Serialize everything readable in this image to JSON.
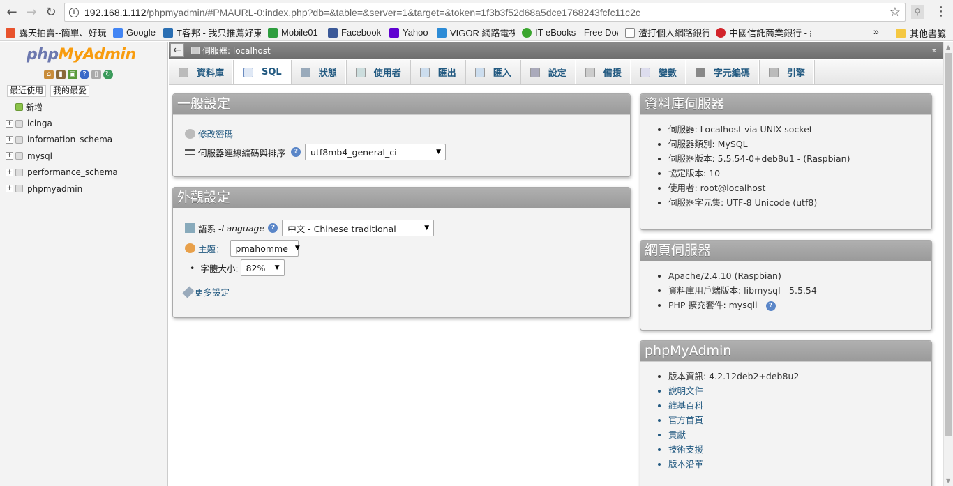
{
  "browser": {
    "url_host": "192.168.1.112",
    "url_rest": "/phpmyadmin/#PMAURL-0:index.php?db=&table=&server=1&target=&token=1f3b3f52d68a5dce1768243fcfc11c2c",
    "bookmarks": [
      {
        "label": "露天拍賣--簡單、好玩",
        "color": "#e8532d"
      },
      {
        "label": "Google",
        "color": "#4285f4"
      },
      {
        "label": "T客邦 - 我只推薦好東",
        "color": "#2b6fb3"
      },
      {
        "label": "Mobile01",
        "color": "#2e9e3f"
      },
      {
        "label": "Facebook",
        "color": "#3b5998"
      },
      {
        "label": "Yahoo",
        "color": "#5f01d1"
      },
      {
        "label": "VIGOR 網路電視",
        "color": "#2c8bd6"
      },
      {
        "label": "IT eBooks - Free Dow",
        "color": "#3aa52e"
      },
      {
        "label": "渣打個人網路銀行",
        "color": "#dddddd"
      },
      {
        "label": "中國信託商業銀行 - 網",
        "color": "#d2232a"
      }
    ],
    "more": "»",
    "other_bookmarks": "其他書籤"
  },
  "sidebar": {
    "logo_php": "php",
    "logo_myadmin": "MyAdmin",
    "recent": "最近使用",
    "favorites": "我的最愛",
    "new_label": "新增",
    "databases": [
      "icinga",
      "information_schema",
      "mysql",
      "performance_schema",
      "phpmyadmin"
    ]
  },
  "serverbar": {
    "label": "伺服器: localhost"
  },
  "tabs": [
    {
      "label": "資料庫",
      "icon": "database-icon"
    },
    {
      "label": "SQL",
      "icon": "sql-icon"
    },
    {
      "label": "狀態",
      "icon": "status-icon"
    },
    {
      "label": "使用者",
      "icon": "users-icon"
    },
    {
      "label": "匯出",
      "icon": "export-icon"
    },
    {
      "label": "匯入",
      "icon": "import-icon"
    },
    {
      "label": "設定",
      "icon": "wrench-icon"
    },
    {
      "label": "備援",
      "icon": "replication-icon"
    },
    {
      "label": "變數",
      "icon": "variables-icon"
    },
    {
      "label": "字元編碼",
      "icon": "charset-icon"
    },
    {
      "label": "引擎",
      "icon": "engine-icon"
    }
  ],
  "general": {
    "title": "一般設定",
    "change_password": "修改密碼",
    "collation_label": "伺服器連線編碼與排序",
    "collation_value": "utf8mb4_general_ci"
  },
  "appearance": {
    "title": "外觀設定",
    "language_label": "語系 - ",
    "language_italic": "Language",
    "language_value": "中文 - Chinese traditional",
    "theme_label": "主題：",
    "theme_value": "pmahomme",
    "font_label": "字體大小:",
    "font_value": "82%",
    "more_settings": "更多設定"
  },
  "db_server": {
    "title": "資料庫伺服器",
    "items": [
      "伺服器: Localhost via UNIX socket",
      "伺服器類別: MySQL",
      "伺服器版本: 5.5.54-0+deb8u1 - (Raspbian)",
      "協定版本: 10",
      "使用者: root@localhost",
      "伺服器字元集: UTF-8 Unicode (utf8)"
    ]
  },
  "web_server": {
    "title": "網頁伺服器",
    "items": [
      "Apache/2.4.10 (Raspbian)",
      "資料庫用戶端版本: libmysql - 5.5.54",
      "PHP 擴充套件: mysqli"
    ]
  },
  "pma": {
    "title": "phpMyAdmin",
    "version": "版本資訊: 4.2.12deb2+deb8u2",
    "links": [
      "說明文件",
      "維基百科",
      "官方首頁",
      "貢獻",
      "技術支援",
      "版本沿革"
    ]
  }
}
